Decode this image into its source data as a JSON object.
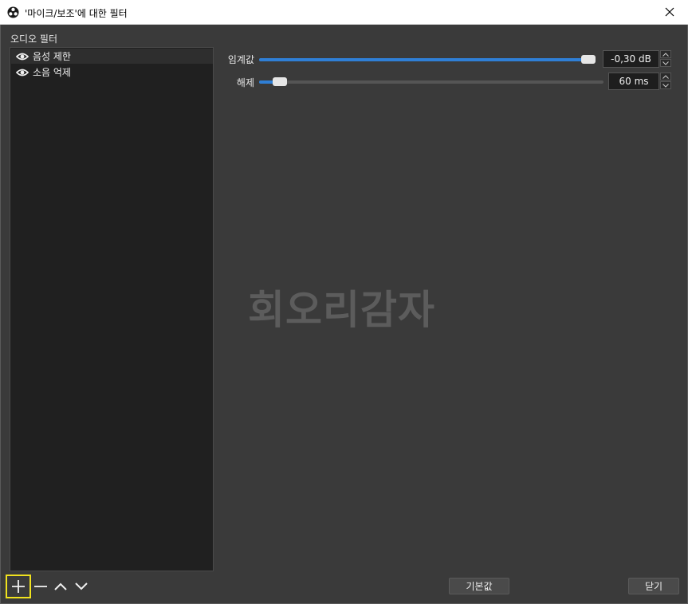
{
  "window": {
    "title": "'마이크/보조'에 대한 필터",
    "close_icon": "close-icon",
    "app_icon": "obs-logo-icon"
  },
  "filters": {
    "section_label": "오디오 필터",
    "items": [
      {
        "label": "음성 제한",
        "icon": "eye-icon",
        "selected": true
      },
      {
        "label": "소음 억제",
        "icon": "eye-icon",
        "selected": false
      }
    ]
  },
  "toolbar": {
    "add_icon": "plus-icon",
    "remove_icon": "minus-icon",
    "up_icon": "chevron-up-icon",
    "down_icon": "chevron-down-icon"
  },
  "properties": {
    "threshold": {
      "label": "임계값",
      "value": "-0,30 dB",
      "fill_fraction": 0.99
    },
    "release": {
      "label": "해제",
      "value": "60 ms",
      "fill_fraction": 0.06
    }
  },
  "watermark": "회오리감자",
  "buttons": {
    "defaults": "기본값",
    "close": "닫기"
  },
  "colors": {
    "accent": "#2f7fd6",
    "highlight": "#f0e21e"
  }
}
